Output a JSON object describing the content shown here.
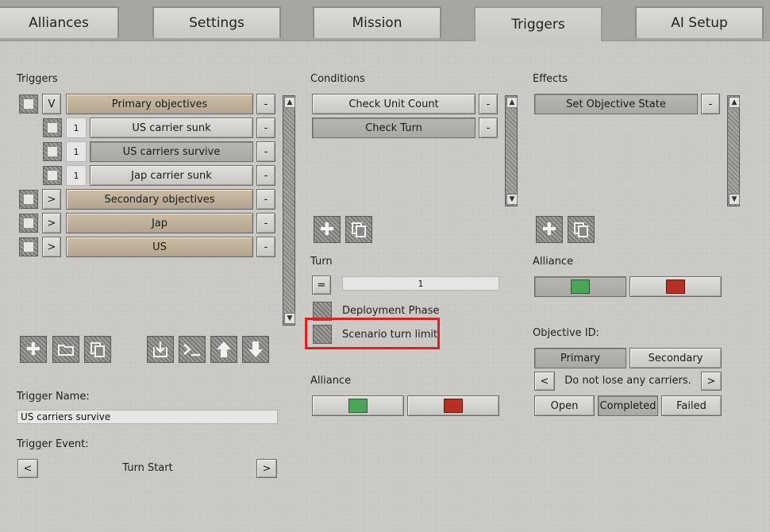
{
  "tabs": [
    "Alliances",
    "Settings",
    "Mission",
    "Triggers",
    "AI Setup"
  ],
  "triggers_panel": {
    "title": "Triggers",
    "items": [
      {
        "toggle": "V",
        "label": "Primary objectives",
        "remove": "-"
      },
      {
        "count": "1",
        "label": "US carrier sunk",
        "remove": "-"
      },
      {
        "count": "1",
        "label": "US carriers survive",
        "remove": "-"
      },
      {
        "count": "1",
        "label": "Jap carrier sunk",
        "remove": "-"
      },
      {
        "toggle": ">",
        "label": "Secondary objectives",
        "remove": "-"
      },
      {
        "toggle": ">",
        "label": "Jap",
        "remove": "-"
      },
      {
        "toggle": ">",
        "label": "US",
        "remove": "-"
      }
    ],
    "trigger_name_label": "Trigger Name:",
    "trigger_name_value": "US carriers survive",
    "trigger_event_label": "Trigger Event:",
    "trigger_event_value": "Turn Start",
    "prev": "<",
    "next": ">"
  },
  "conditions_panel": {
    "title": "Conditions",
    "items": [
      {
        "label": "Check Unit Count",
        "remove": "-"
      },
      {
        "label": "Check Turn",
        "remove": "-"
      }
    ],
    "turn_label": "Turn",
    "operator": "=",
    "turn_value": "1",
    "deployment_phase": "Deployment Phase",
    "scenario_turn_limit": "Scenario turn limit",
    "alliance_label": "Alliance"
  },
  "effects_panel": {
    "title": "Effects",
    "items": [
      {
        "label": "Set Objective State",
        "remove": "-"
      }
    ],
    "alliance_label": "Alliance",
    "objective_id_label": "Objective ID:",
    "objective_types": [
      "Primary",
      "Secondary"
    ],
    "objective_text": "Do not lose any carriers.",
    "prev": "<",
    "next": ">",
    "states": [
      "Open",
      "Completed",
      "Failed"
    ]
  },
  "colors": {
    "green_alliance": "#4aa558",
    "red_alliance": "#b53025",
    "highlight": "#e02020"
  }
}
